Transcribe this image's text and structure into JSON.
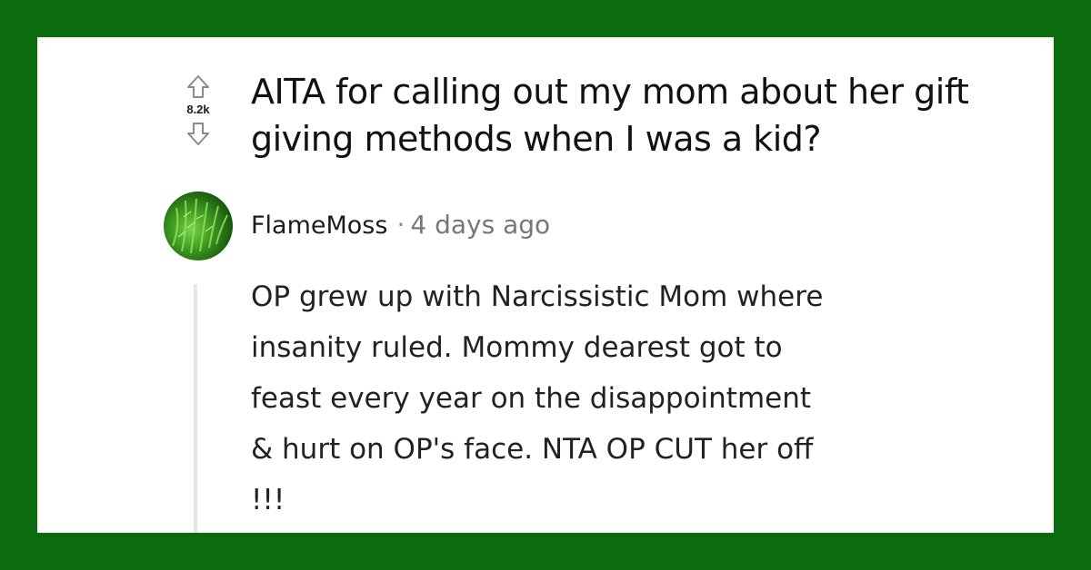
{
  "colors": {
    "frame": "#0b6b0f",
    "card": "#ffffff",
    "title_text": "#111111",
    "meta_text": "#777777",
    "username_text": "#1c1c1c",
    "thread_line": "#e6e6e6"
  },
  "post": {
    "vote_count": "8.2k",
    "upvote_icon": "arrow-up-outline-icon",
    "downvote_icon": "arrow-down-outline-icon",
    "title": "AITA for calling out my mom about her gift giving methods when I was a kid?"
  },
  "comment": {
    "avatar_icon": "moss-avatar",
    "username": "FlameMoss",
    "separator": "·",
    "timestamp": "4 days ago",
    "body": "OP grew up with Narcissistic Mom where insanity ruled. Mommy dearest got to feast every year on the disappointment & hurt on OP's face. NTA OP CUT her off !!!"
  }
}
